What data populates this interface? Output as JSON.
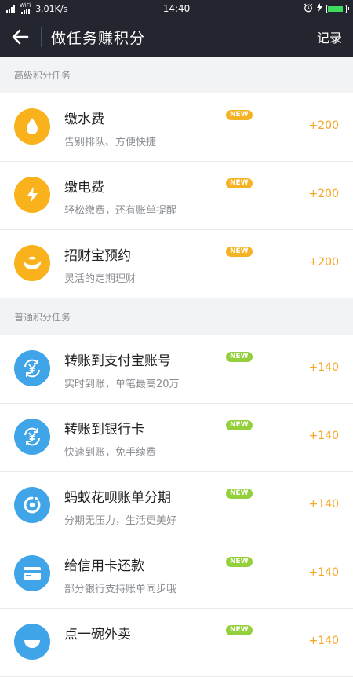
{
  "status_bar": {
    "network_label": "WiFi",
    "speed": "3.01K/s",
    "time": "14:40",
    "battery_level": 0.8,
    "icons": [
      "signal-icon",
      "wifi-icon",
      "alarm-icon",
      "charging-icon",
      "battery-icon"
    ]
  },
  "nav": {
    "title": "做任务赚积分",
    "record_label": "记录",
    "back_icon": "arrow-left-icon"
  },
  "sections": [
    {
      "title": "高级积分任务",
      "tasks": [
        {
          "title": "缴水费",
          "subtitle": "告别排队、方便快捷",
          "badge": "NEW",
          "points": "+200",
          "icon": "water-drop-icon",
          "icon_color": "#f9b21c",
          "badge_color": "#f5b324"
        },
        {
          "title": "缴电费",
          "subtitle": "轻松缴费，还有账单提醒",
          "badge": "NEW",
          "points": "+200",
          "icon": "lightning-icon",
          "icon_color": "#f9b21c",
          "badge_color": "#f5b324"
        },
        {
          "title": "招财宝预约",
          "subtitle": "灵活的定期理财",
          "badge": "NEW",
          "points": "+200",
          "icon": "piggy-icon",
          "icon_color": "#f9b21c",
          "badge_color": "#f5b324"
        }
      ]
    },
    {
      "title": "普通积分任务",
      "tasks": [
        {
          "title": "转账到支付宝账号",
          "subtitle": "实时到账，单笔最高20万",
          "badge": "NEW",
          "points": "+140",
          "icon": "yuan-transfer-icon",
          "icon_color": "#3fa4e8",
          "badge_color": "#94cf3c"
        },
        {
          "title": "转账到银行卡",
          "subtitle": "快速到账，免手续费",
          "badge": "NEW",
          "points": "+140",
          "icon": "yuan-transfer-icon",
          "icon_color": "#3fa4e8",
          "badge_color": "#94cf3c"
        },
        {
          "title": "蚂蚁花呗账单分期",
          "subtitle": "分期无压力，生活更美好",
          "badge": "NEW",
          "points": "+140",
          "icon": "huabei-icon",
          "icon_color": "#3fa4e8",
          "badge_color": "#94cf3c"
        },
        {
          "title": "给信用卡还款",
          "subtitle": "部分银行支持账单同步哦",
          "badge": "NEW",
          "points": "+140",
          "icon": "credit-card-icon",
          "icon_color": "#3fa4e8",
          "badge_color": "#94cf3c"
        },
        {
          "title": "点一碗外卖",
          "subtitle": "",
          "badge": "NEW",
          "points": "+140",
          "icon": "takeout-icon",
          "icon_color": "#3fa4e8",
          "badge_color": "#94cf3c"
        }
      ]
    }
  ]
}
